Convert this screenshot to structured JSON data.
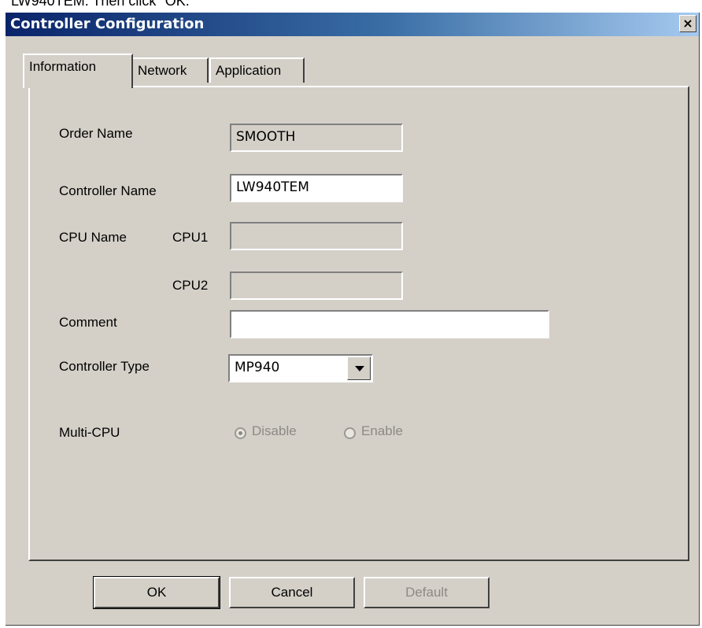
{
  "document_text": "LW940TEM.    Then click \"OK.\"",
  "dialog": {
    "title": "Controller Configuration",
    "close_label": "×"
  },
  "tabs": [
    {
      "label": "Information",
      "active": true
    },
    {
      "label": "Network",
      "active": false
    },
    {
      "label": "Application",
      "active": false
    }
  ],
  "form": {
    "order_name_label": "Order Name",
    "order_name_value": "SMOOTH",
    "controller_name_label": "Controller Name",
    "controller_name_value": "LW940TEM",
    "cpu_name_label": "CPU Name",
    "cpu1_label": "CPU1",
    "cpu1_value": "",
    "cpu2_label": "CPU2",
    "cpu2_value": "",
    "comment_label": "Comment",
    "comment_value": "",
    "controller_type_label": "Controller Type",
    "controller_type_value": "MP940",
    "multi_cpu_label": "Multi-CPU",
    "multi_cpu_options": [
      {
        "label": "Disable",
        "checked": true,
        "disabled": true
      },
      {
        "label": "Enable",
        "checked": false,
        "disabled": true
      }
    ]
  },
  "buttons": {
    "ok": "OK",
    "cancel": "Cancel",
    "default": "Default"
  }
}
